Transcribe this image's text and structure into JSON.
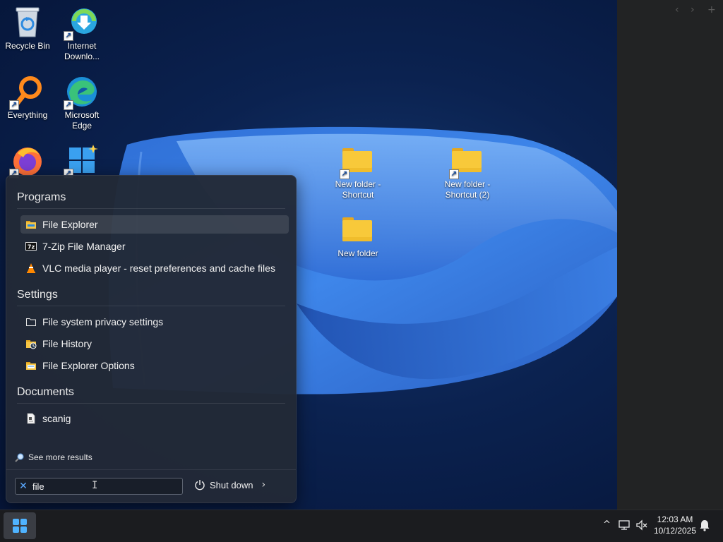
{
  "desktop": {
    "icons": [
      {
        "label": "Recycle Bin",
        "icon": "recycle-bin-icon"
      },
      {
        "label": "Internet Downlo...",
        "icon": "internet-download-manager-icon"
      },
      {
        "label": "Everything",
        "icon": "everything-search-icon"
      },
      {
        "label": "Microsoft Edge",
        "icon": "edge-icon"
      },
      {
        "label": "",
        "icon": "firefox-icon"
      },
      {
        "label": "",
        "icon": "windows-app-icon"
      },
      {
        "label": "New folder - Shortcut",
        "icon": "folder-shortcut-icon"
      },
      {
        "label": "New folder - Shortcut (2)",
        "icon": "folder-shortcut-icon"
      },
      {
        "label": "New folder",
        "icon": "folder-icon"
      }
    ]
  },
  "side_panel": {
    "prev": "‹",
    "next": "›",
    "add": "+"
  },
  "search_menu": {
    "groups": {
      "programs": "Programs",
      "settings": "Settings",
      "documents": "Documents"
    },
    "programs": [
      {
        "label": "File Explorer",
        "icon": "file-explorer-icon",
        "selected": true
      },
      {
        "label": "7-Zip File Manager",
        "icon": "7zip-icon"
      },
      {
        "label": "VLC media player - reset preferences and cache files",
        "icon": "vlc-cone-icon"
      }
    ],
    "settings": [
      {
        "label": "File system privacy settings",
        "icon": "folder-outline-icon"
      },
      {
        "label": "File History",
        "icon": "file-history-icon"
      },
      {
        "label": "File Explorer Options",
        "icon": "folder-options-icon"
      }
    ],
    "documents": [
      {
        "label": "scanig",
        "icon": "document-icon"
      }
    ],
    "see_more": "See more results",
    "search_value": "file",
    "shutdown_label": "Shut down",
    "shutdown_arrow": "›"
  },
  "taskbar": {
    "time": "12:03 AM",
    "date": "10/12/2025",
    "tray_chevron": "^"
  },
  "colors": {
    "accent": "#5aa9ff",
    "taskbar": "#1b1c1f",
    "menu": "#222937",
    "folder": "#f8c93a"
  }
}
